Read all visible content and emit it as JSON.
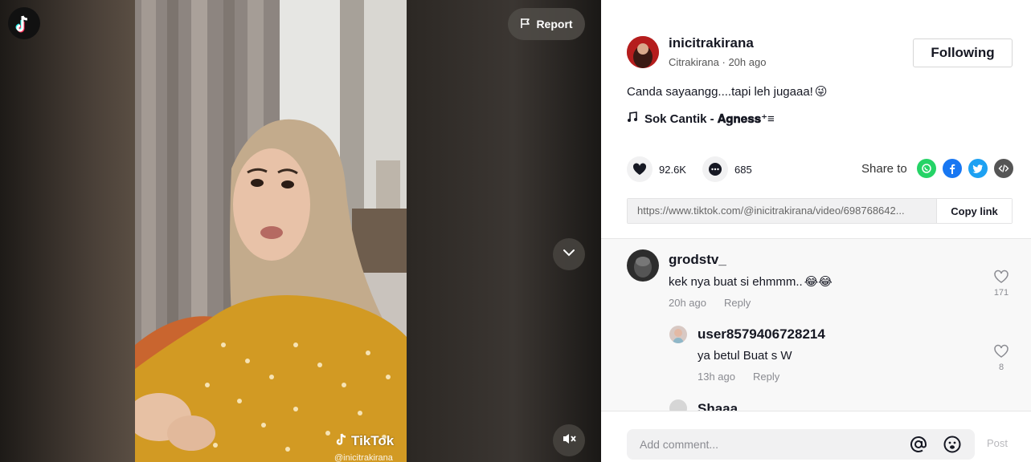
{
  "video": {
    "report_label": "Report",
    "watermark_brand": "TikTok",
    "watermark_handle": "@inicitrakirana"
  },
  "author": {
    "username": "inicitrakirana",
    "display_name": "Citrakirana",
    "posted": "20h ago",
    "follow_label": "Following"
  },
  "post": {
    "caption": "Canda sayaangg....tapi leh jugaaa!",
    "caption_emoji": "😜",
    "music": "Sok Cantik - 𝐀𝐠𝐧𝐞𝐬𝐬⁺≡"
  },
  "stats": {
    "likes": "92.6K",
    "comments": "685"
  },
  "share": {
    "label": "Share to",
    "targets": [
      "whatsapp-icon",
      "facebook-icon",
      "twitter-icon",
      "embed-icon"
    ]
  },
  "link": {
    "url": "https://www.tiktok.com/@inicitrakirana/video/698768642...",
    "copy_label": "Copy link"
  },
  "comments": [
    {
      "user": "grodstv_",
      "text": "kek nya buat si ehmmm..",
      "emoji": "😂😂",
      "time": "20h ago",
      "reply": "Reply",
      "likes": "171"
    },
    {
      "user": "user8579406728214",
      "text": "ya betul Buat s W",
      "time": "13h ago",
      "reply": "Reply",
      "likes": "8"
    },
    {
      "user": "Shaaa"
    }
  ],
  "composer": {
    "placeholder": "Add comment...",
    "post_label": "Post"
  },
  "colors": {
    "whatsapp": "#25D366",
    "facebook": "#1877F2",
    "twitter": "#1DA1F2",
    "embed": "#555555",
    "brand_cyan": "#25F4EE",
    "brand_red": "#FE2C55"
  }
}
